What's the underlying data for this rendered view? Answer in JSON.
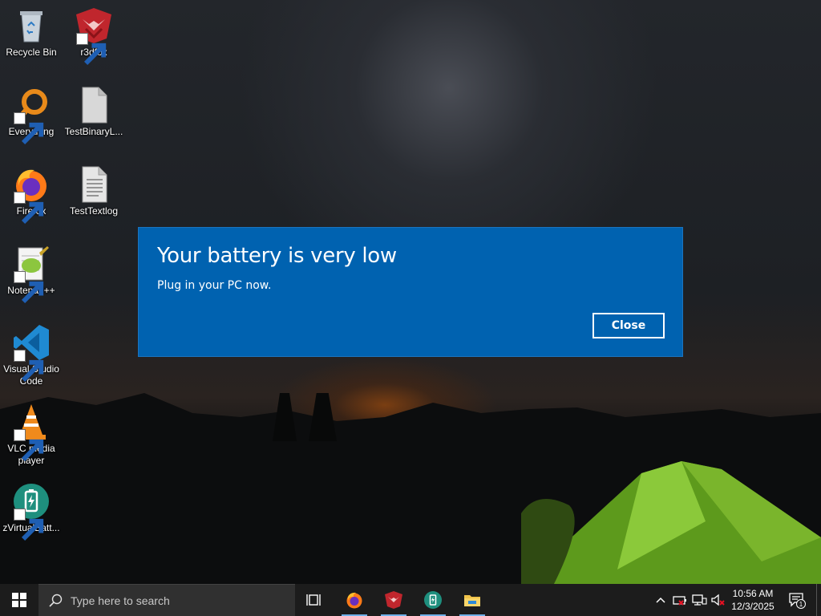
{
  "desktop": {
    "icons": [
      {
        "label": "Recycle Bin",
        "icon": "recycle-bin-icon"
      },
      {
        "label": "r3dfox",
        "icon": "r3dfox-icon"
      },
      {
        "label": "Everything",
        "icon": "everything-search-icon"
      },
      {
        "label": "TestBinaryL...",
        "icon": "file-icon"
      },
      {
        "label": "Firefox",
        "icon": "firefox-icon"
      },
      {
        "label": "TestTextlog",
        "icon": "text-file-icon"
      },
      {
        "label": "Notepad++",
        "icon": "notepad-plus-plus-icon"
      },
      {
        "label": "Visual Studio Code",
        "icon": "vscode-icon"
      },
      {
        "label": "VLC media player",
        "icon": "vlc-icon"
      },
      {
        "label": "zVirtualBatt...",
        "icon": "virtual-battery-icon"
      }
    ]
  },
  "toast": {
    "title": "Your battery is very low",
    "message": "Plug in your PC now.",
    "close_label": "Close",
    "background_color": "#0062b0"
  },
  "taskbar": {
    "search_placeholder": "Type here to search",
    "apps": [
      {
        "name": "Task View",
        "icon": "task-view-icon"
      },
      {
        "name": "Firefox",
        "icon": "firefox-icon"
      },
      {
        "name": "r3dfox",
        "icon": "r3dfox-icon"
      },
      {
        "name": "zVirtualBattery",
        "icon": "virtual-battery-icon"
      },
      {
        "name": "File Explorer",
        "icon": "file-explorer-icon"
      }
    ],
    "tray": {
      "icons": [
        "chevron-up-icon",
        "battery-warning-icon",
        "network-icon",
        "volume-muted-icon"
      ],
      "time": "10:56 AM",
      "date": "12/3/2025",
      "notification_count": "1"
    }
  }
}
